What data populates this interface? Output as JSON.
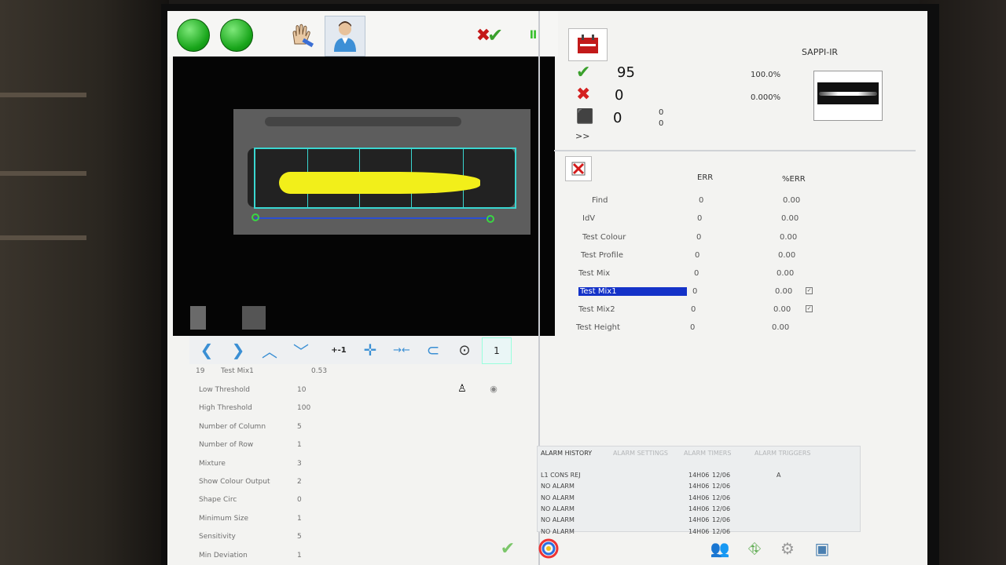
{
  "toolbar": {
    "run_label": "",
    "ack_label": "",
    "pause_symbol": "II"
  },
  "stats": {
    "product": "SAPPI-IR",
    "pass_count": "95",
    "pass_pct": "100.0%",
    "fail_count": "0",
    "fail_pct": "0.000%",
    "box_count": "0",
    "box_a": "0",
    "box_b": "0",
    "more": ">>"
  },
  "tests": {
    "col_err": "ERR",
    "col_pct": "%ERR",
    "rows": [
      {
        "name": "Find",
        "err": "0",
        "pct": "0.00"
      },
      {
        "name": "IdV",
        "err": "0",
        "pct": "0.00"
      },
      {
        "name": "Test Colour",
        "err": "0",
        "pct": "0.00"
      },
      {
        "name": "Test Profile",
        "err": "0",
        "pct": "0.00"
      },
      {
        "name": "Test Mix",
        "err": "0",
        "pct": "0.00"
      },
      {
        "name": "Test Mix1",
        "err": "0",
        "pct": "0.00"
      },
      {
        "name": "Test Mix2",
        "err": "0",
        "pct": "0.00"
      },
      {
        "name": "Test Height",
        "err": "0",
        "pct": "0.00"
      }
    ]
  },
  "nav": {
    "step_label": "+-1",
    "page": "1"
  },
  "params": {
    "header_id": "19",
    "header_name": "Test Mix1",
    "header_val": "0.53",
    "rows": [
      {
        "label": "Low Threshold",
        "value": "10"
      },
      {
        "label": "High Threshold",
        "value": "100"
      },
      {
        "label": "Number of Column",
        "value": "5"
      },
      {
        "label": "Number of Row",
        "value": "1"
      },
      {
        "label": "Mixture",
        "value": "3"
      },
      {
        "label": "Show Colour Output",
        "value": "2"
      },
      {
        "label": "Shape Circ",
        "value": "0"
      },
      {
        "label": "Minimum Size",
        "value": "1"
      },
      {
        "label": "Sensitivity",
        "value": "5"
      },
      {
        "label": "Min Deviation",
        "value": "1"
      }
    ]
  },
  "alarm": {
    "tabs": [
      "ALARM HISTORY",
      "ALARM SETTINGS",
      "ALARM TIMERS",
      "ALARM TRIGGERS"
    ],
    "rows": [
      {
        "text": "L1 CONS REJ",
        "time": "14H06",
        "date": "12/06",
        "flag": "A"
      },
      {
        "text": "NO ALARM",
        "time": "14H06",
        "date": "12/06",
        "flag": ""
      },
      {
        "text": "NO ALARM",
        "time": "14H06",
        "date": "12/06",
        "flag": ""
      },
      {
        "text": "NO ALARM",
        "time": "14H06",
        "date": "12/06",
        "flag": ""
      },
      {
        "text": "NO ALARM",
        "time": "14H06",
        "date": "12/06",
        "flag": ""
      },
      {
        "text": "NO ALARM",
        "time": "14H06",
        "date": "12/06",
        "flag": ""
      }
    ]
  },
  "colors": {
    "selection": "#1432c8",
    "roi": "#3ad6d0",
    "blob": "#f2ef1a",
    "ok": "#2fa02a",
    "err": "#d42020"
  }
}
